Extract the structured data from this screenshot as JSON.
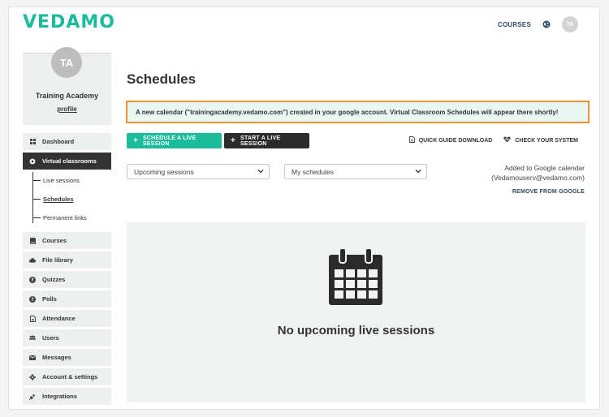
{
  "brand": {
    "logo_text": "VEDAMO",
    "accent": "#1abc9c"
  },
  "topnav": {
    "courses_label": "COURSES",
    "avatar_initials": "TA",
    "language_icon": "globe-icon"
  },
  "profile": {
    "initials": "TA",
    "name": "Training Academy",
    "link_label": "profile"
  },
  "sidebar": {
    "items_top": [
      {
        "label": "Dashboard",
        "icon": "grid-icon"
      }
    ],
    "active_item": {
      "label": "Virtual classrooms",
      "icon": "gear-icon"
    },
    "sub_items": [
      {
        "label": "Live sessions"
      },
      {
        "label": "Schedules"
      },
      {
        "label": "Permanent links"
      }
    ],
    "items_bottom": [
      {
        "label": "Courses",
        "icon": "book-icon"
      },
      {
        "label": "File library",
        "icon": "cloud-icon"
      },
      {
        "label": "Quizzes",
        "icon": "question-icon"
      },
      {
        "label": "Polls",
        "icon": "help-icon"
      },
      {
        "label": "Attendance",
        "icon": "document-icon"
      },
      {
        "label": "Users",
        "icon": "users-icon"
      },
      {
        "label": "Messages",
        "icon": "envelope-icon"
      },
      {
        "label": "Account & settings",
        "icon": "cog-icon"
      },
      {
        "label": "Integrations",
        "icon": "plug-icon"
      }
    ]
  },
  "main": {
    "title": "Schedules",
    "alert_text": "A new calendar (\"trainingacademy.vedamo.com\") created in your google account. Virtual Classroom Schedules will appear there shortly!",
    "buttons": {
      "schedule_label": "SCHEDULE A LIVE SESSION",
      "start_label": "START A LIVE SESSION"
    },
    "actions": {
      "guide_label": "QUICK GUIDE DOWNLOAD",
      "check_label": "CHECK YOUR SYSTEM"
    },
    "filters": {
      "sessions_selected": "Upcoming sessions",
      "schedules_selected": "My schedules"
    },
    "google": {
      "line1": "Added to Google calendar",
      "line2": "(Vedamouserv@vedamo.com)",
      "remove_label": "REMOVE FROM GOOGLE"
    },
    "empty_state": {
      "text": "No upcoming live sessions",
      "icon": "calendar-icon"
    }
  }
}
